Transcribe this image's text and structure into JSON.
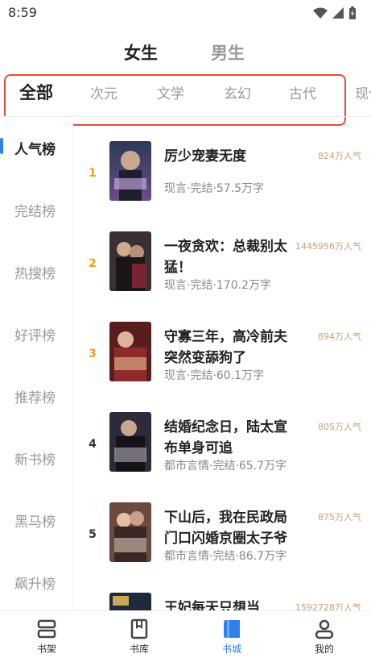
{
  "status": {
    "time": "8:59"
  },
  "gender_tabs": [
    "女生",
    "男生"
  ],
  "categories": [
    "全部",
    "次元",
    "文学",
    "玄幻",
    "古代",
    "现代"
  ],
  "sidebar": [
    "人气榜",
    "完结榜",
    "热搜榜",
    "好评榜",
    "推荐榜",
    "新书榜",
    "黑马榜",
    "飙升榜"
  ],
  "books": [
    {
      "rank": "1",
      "title": "厉少宠妻无度",
      "meta": "现言·完结·57.5万字",
      "popularity": "824万人气"
    },
    {
      "rank": "2",
      "title": "一夜贪欢：总裁别太猛！",
      "meta": "现言·完结·170.2万字",
      "popularity": "1445956万人气"
    },
    {
      "rank": "3",
      "title": "守寡三年，高冷前夫突然变舔狗了",
      "meta": "现言·完结·60.1万字",
      "popularity": "894万人气"
    },
    {
      "rank": "4",
      "title": "结婚纪念日，陆太宣布单身可追",
      "meta": "都市言情·完结·65.7万字",
      "popularity": "805万人气"
    },
    {
      "rank": "5",
      "title": "下山后，我在民政局门口闪婚京圈太子爷",
      "meta": "都市言情·完结·86.7万字",
      "popularity": "875万人气"
    },
    {
      "rank": "",
      "title": "王妃每天只想当",
      "meta": "",
      "popularity": "1592728万人气"
    }
  ],
  "bottom_nav": [
    "书架",
    "书库",
    "书城",
    "我的"
  ],
  "colors": {
    "accent": "#2f80ed",
    "rank_highlight": "#f39c12",
    "popularity": "#c9a17a",
    "outline": "#e74c3c"
  }
}
